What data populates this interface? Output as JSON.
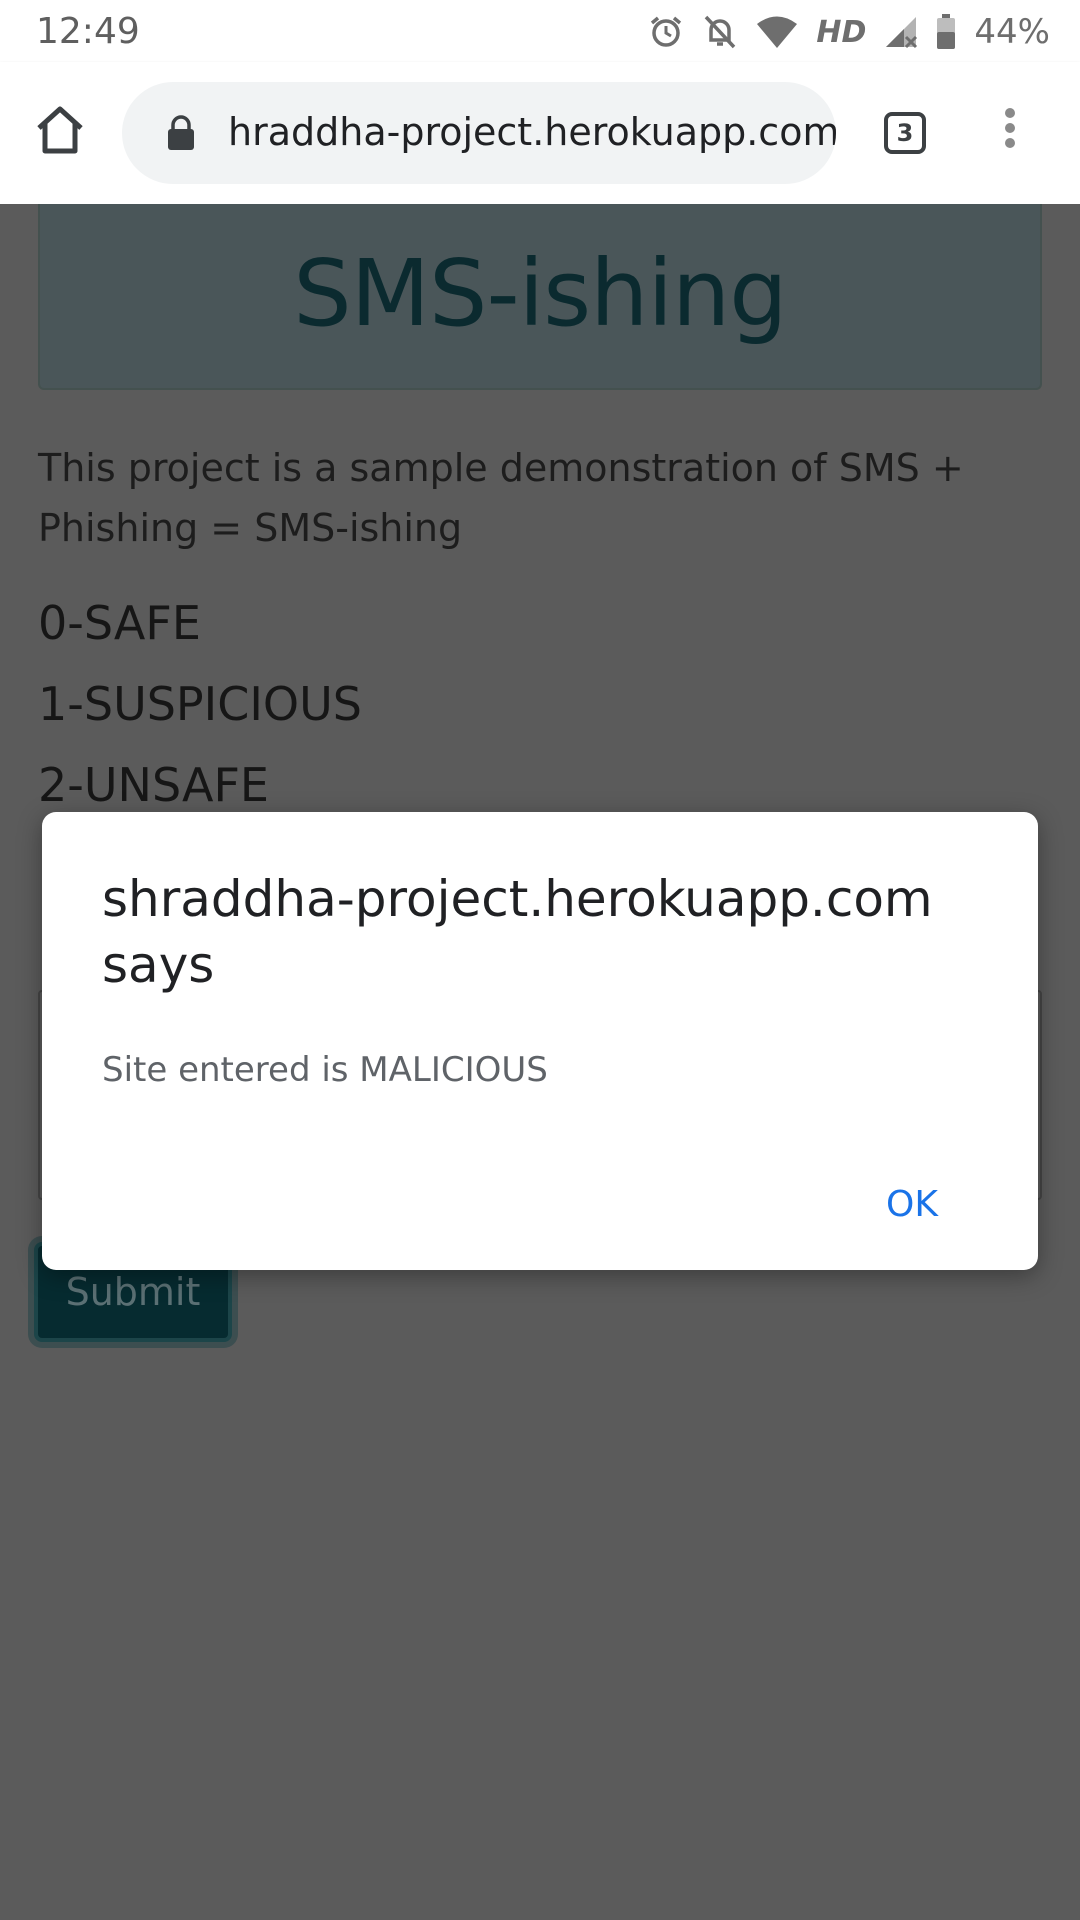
{
  "status_bar": {
    "time": "12:49",
    "network_label": "HD",
    "battery_percent": "44%",
    "icons": [
      "alarm-icon",
      "notifications-off-icon",
      "wifi-icon",
      "cell-signal-icon",
      "battery-icon"
    ]
  },
  "browser": {
    "url": "hraddha-project.herokuapp.com",
    "tab_count": "3",
    "icons": [
      "home-icon",
      "lock-icon",
      "tab-switcher-icon",
      "more-menu-icon"
    ]
  },
  "page": {
    "title": "SMS-ishing",
    "intro": "This project is a sample demonstration of SMS + Phishing = SMS-ishing",
    "legend": [
      {
        "text": "0-SAFE"
      },
      {
        "text": "1-SUSPICIOUS"
      },
      {
        "text": "2-UNSAFE"
      }
    ],
    "submit_label": "Submit",
    "colors": {
      "jumbotron": "#4a5659",
      "title": "#0b2a2f",
      "submit_bg": "#062b30"
    }
  },
  "dialog": {
    "title": "shraddha-project.herokuapp.com says",
    "message": "Site entered is MALICIOUS",
    "ok_label": "OK",
    "ok_color": "#1a73e8"
  }
}
